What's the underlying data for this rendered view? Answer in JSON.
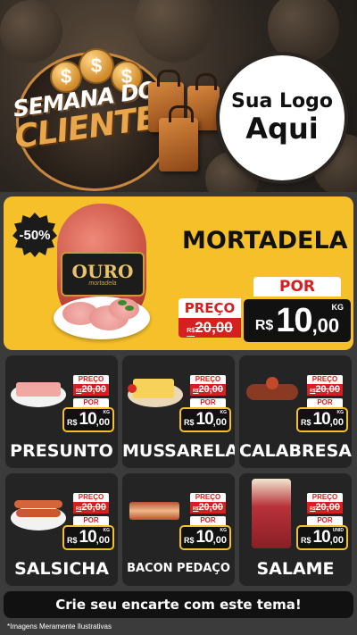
{
  "hero": {
    "title_line1": "SEMANA DO",
    "title_line2": "CLIENTE",
    "logo_line1": "Sua Logo",
    "logo_line2": "Aqui",
    "dollar_symbol": "$"
  },
  "featured": {
    "discount": "-50%",
    "brand": "OURO",
    "brand_sub": "mortadela",
    "name": "MORTADELA",
    "preco_label": "PREÇO",
    "old_currency": "R$",
    "old_price": "20,00",
    "por_label": "POR",
    "currency": "R$",
    "price_int": "10",
    "price_dec": ",00",
    "unit": "KG"
  },
  "products": [
    {
      "name": "PRESUNTO",
      "preco_label": "PREÇO",
      "old_currency": "R$",
      "old_price": "20,00",
      "por_label": "POR",
      "currency": "R$",
      "price_int": "10",
      "price_dec": ",00",
      "unit": "KG"
    },
    {
      "name": "MUSSARELA",
      "preco_label": "PREÇO",
      "old_currency": "R$",
      "old_price": "20,00",
      "por_label": "POR",
      "currency": "R$",
      "price_int": "10",
      "price_dec": ",00",
      "unit": "KG"
    },
    {
      "name": "CALABRESA",
      "preco_label": "PREÇO",
      "old_currency": "R$",
      "old_price": "20,00",
      "por_label": "POR",
      "currency": "R$",
      "price_int": "10",
      "price_dec": ",00",
      "unit": "KG"
    },
    {
      "name": "SALSICHA",
      "preco_label": "PREÇO",
      "old_currency": "R$",
      "old_price": "20,00",
      "por_label": "POR",
      "currency": "R$",
      "price_int": "10",
      "price_dec": ",00",
      "unit": "KG"
    },
    {
      "name": "BACON PEDAÇO",
      "preco_label": "PREÇO",
      "old_currency": "R$",
      "old_price": "20,00",
      "por_label": "POR",
      "currency": "R$",
      "price_int": "10",
      "price_dec": ",00",
      "unit": "KG"
    },
    {
      "name": "SALAME",
      "preco_label": "PREÇO",
      "old_currency": "R$",
      "old_price": "20,00",
      "por_label": "POR",
      "currency": "R$",
      "price_int": "10",
      "price_dec": ",00",
      "unit": "UNID"
    }
  ],
  "cta": "Crie seu encarte com este tema!",
  "disclaimer": "*Imagens Meramente Ilustrativas",
  "colors": {
    "featured_bg": "#f6c02a",
    "card_bg": "#242424",
    "price_red": "#d61f1f",
    "accent_gold": "#e9a64a"
  }
}
